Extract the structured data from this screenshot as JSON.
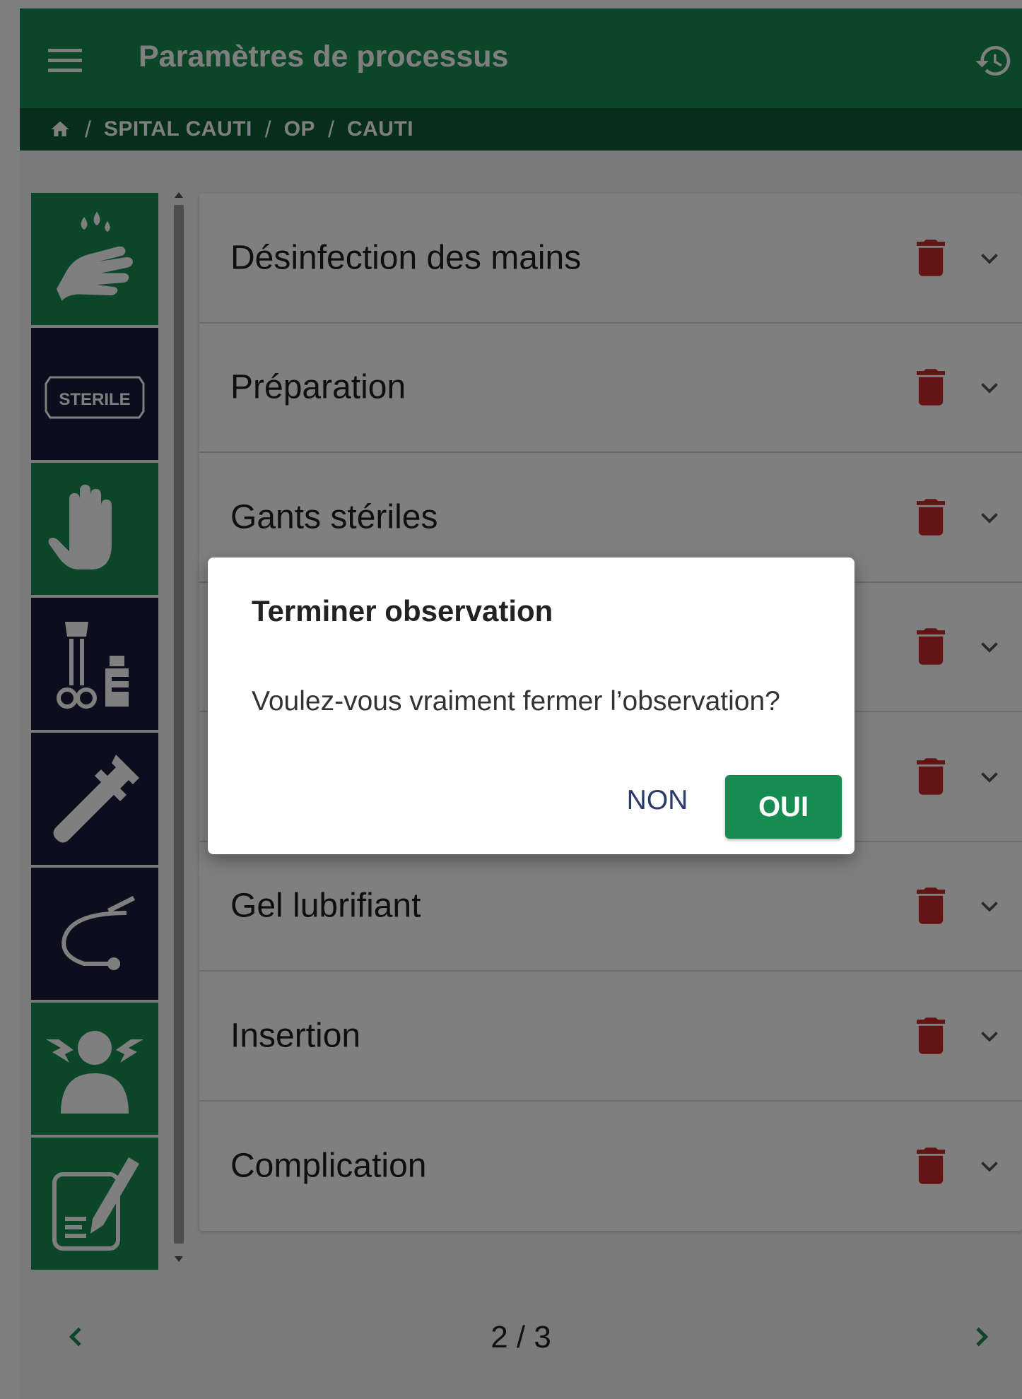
{
  "app_bar": {
    "title": "Paramètres de processus",
    "menu_icon": "hamburger-menu-icon",
    "history_icon": "history-icon"
  },
  "breadcrumb": {
    "home_icon": "home-icon",
    "items": [
      "SPITAL CAUTI",
      "OP",
      "CAUTI"
    ],
    "separator": "/"
  },
  "sidebar": {
    "tiles": [
      {
        "icon": "hand-disinfection-icon",
        "color": "#178c52"
      },
      {
        "icon": "sterile-package-icon",
        "color": "#181c3a",
        "text": "STERILE"
      },
      {
        "icon": "glove-hand-icon",
        "color": "#178c52"
      },
      {
        "icon": "instruments-bottle-icon",
        "color": "#181c3a"
      },
      {
        "icon": "syringe-icon",
        "color": "#181c3a"
      },
      {
        "icon": "catheter-icon",
        "color": "#181c3a"
      },
      {
        "icon": "person-alert-icon",
        "color": "#178c52"
      },
      {
        "icon": "notes-pencil-icon",
        "color": "#178c52"
      }
    ]
  },
  "steps": [
    {
      "label": "Désinfection des mains"
    },
    {
      "label": "Préparation"
    },
    {
      "label": "Gants stériles"
    },
    {
      "label": ""
    },
    {
      "label": ""
    },
    {
      "label": "Gel lubrifiant"
    },
    {
      "label": "Insertion"
    },
    {
      "label": "Complication"
    }
  ],
  "pager": {
    "label": "2 / 3"
  },
  "dialog": {
    "title": "Terminer observation",
    "message": "Voulez-vous vraiment fermer l’observation?",
    "cancel_label": "NON",
    "confirm_label": "OUI"
  },
  "colors": {
    "primary": "#178c52",
    "primary_dark": "#0f5c37",
    "tile_dark": "#181c3a",
    "delete_red": "#c62828"
  }
}
